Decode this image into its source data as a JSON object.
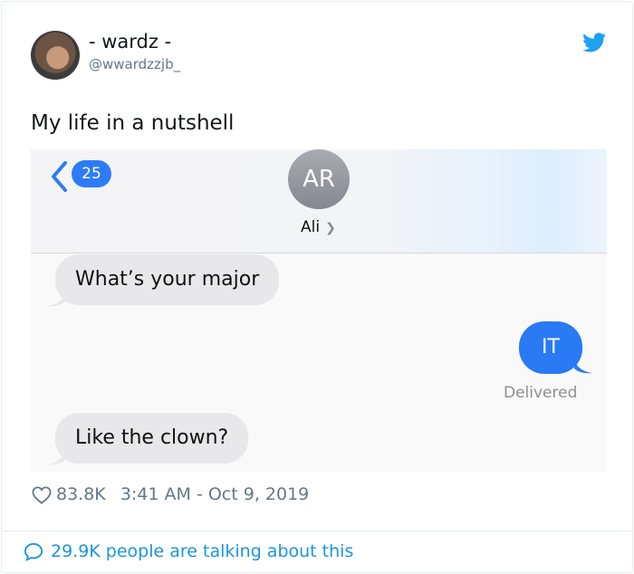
{
  "tweet": {
    "display_name": "- wardz -",
    "handle": "@wwardzzjb_",
    "text": "My life in a nutshell",
    "likes": "83.8K",
    "timestamp": "3:41 AM - Oct 9, 2019",
    "talking": "29.9K people are talking about this",
    "brand_color": "#1da1f2"
  },
  "screenshot": {
    "unread_count": "25",
    "contact_initials": "AR",
    "contact_name": "Ali",
    "messages": [
      {
        "direction": "incoming",
        "text": "What’s your major"
      },
      {
        "direction": "outgoing",
        "text": "IT"
      },
      {
        "direction": "incoming",
        "text": "Like the clown?"
      }
    ],
    "status": "Delivered",
    "bubble_out_color": "#2a7af5",
    "bubble_in_color": "#e8e8ea"
  }
}
